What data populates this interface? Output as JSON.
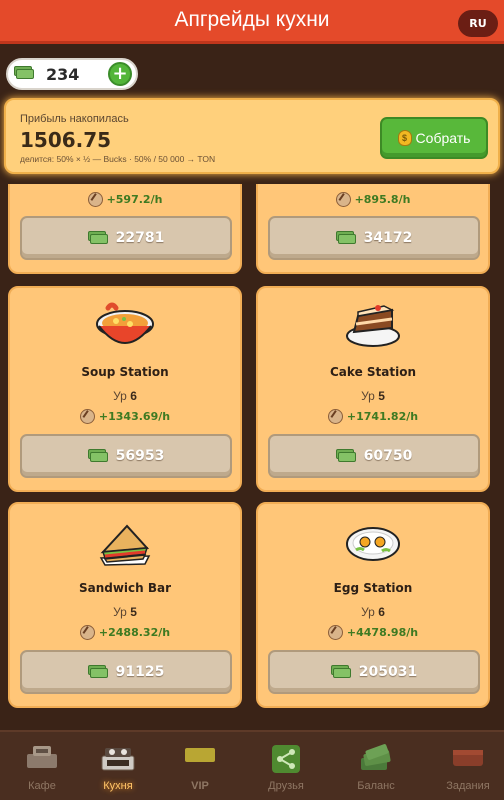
{
  "header": {
    "title": "Апгрейды кухни",
    "lang": "RU"
  },
  "balance": {
    "value": "234",
    "plus": "+"
  },
  "profit": {
    "label": "Прибыль накопилась",
    "amount": "1506.75",
    "note": "делится: 50% × ½ — Bucks · 50% / 50 000 → TON",
    "collect_label": "Собрать",
    "collect_icon_char": "$"
  },
  "cards": [
    {
      "name": "",
      "level_prefix": "",
      "level": "",
      "income": "+597.2/h",
      "price": "22781"
    },
    {
      "name": "",
      "level_prefix": "",
      "level": "",
      "income": "+895.8/h",
      "price": "34172"
    },
    {
      "name": "Soup Station",
      "level_prefix": "Ур",
      "level": "6",
      "income": "+1343.69/h",
      "price": "56953"
    },
    {
      "name": "Cake Station",
      "level_prefix": "Ур",
      "level": "5",
      "income": "+1741.82/h",
      "price": "60750"
    },
    {
      "name": "Sandwich Bar",
      "level_prefix": "Ур",
      "level": "5",
      "income": "+2488.32/h",
      "price": "91125"
    },
    {
      "name": "Egg Station",
      "level_prefix": "Ур",
      "level": "6",
      "income": "+4478.98/h",
      "price": "205031"
    }
  ],
  "nav": [
    {
      "label": "Кафе",
      "icon": "cash-register-icon"
    },
    {
      "label": "Кухня",
      "icon": "stove-icon"
    },
    {
      "label": "VIP",
      "icon": "vip-ticket-icon"
    },
    {
      "label": "Друзья",
      "icon": "share-icon"
    },
    {
      "label": "Баланс",
      "icon": "money-stack-icon"
    },
    {
      "label": "Задания",
      "icon": "briefcase-icon"
    }
  ],
  "colors": {
    "header": "#e44a2a",
    "card": "#ffc678",
    "background": "#3a2317",
    "accent_green": "#58b83a",
    "income_green": "#3e7a22",
    "nav_active": "#ffc468"
  }
}
